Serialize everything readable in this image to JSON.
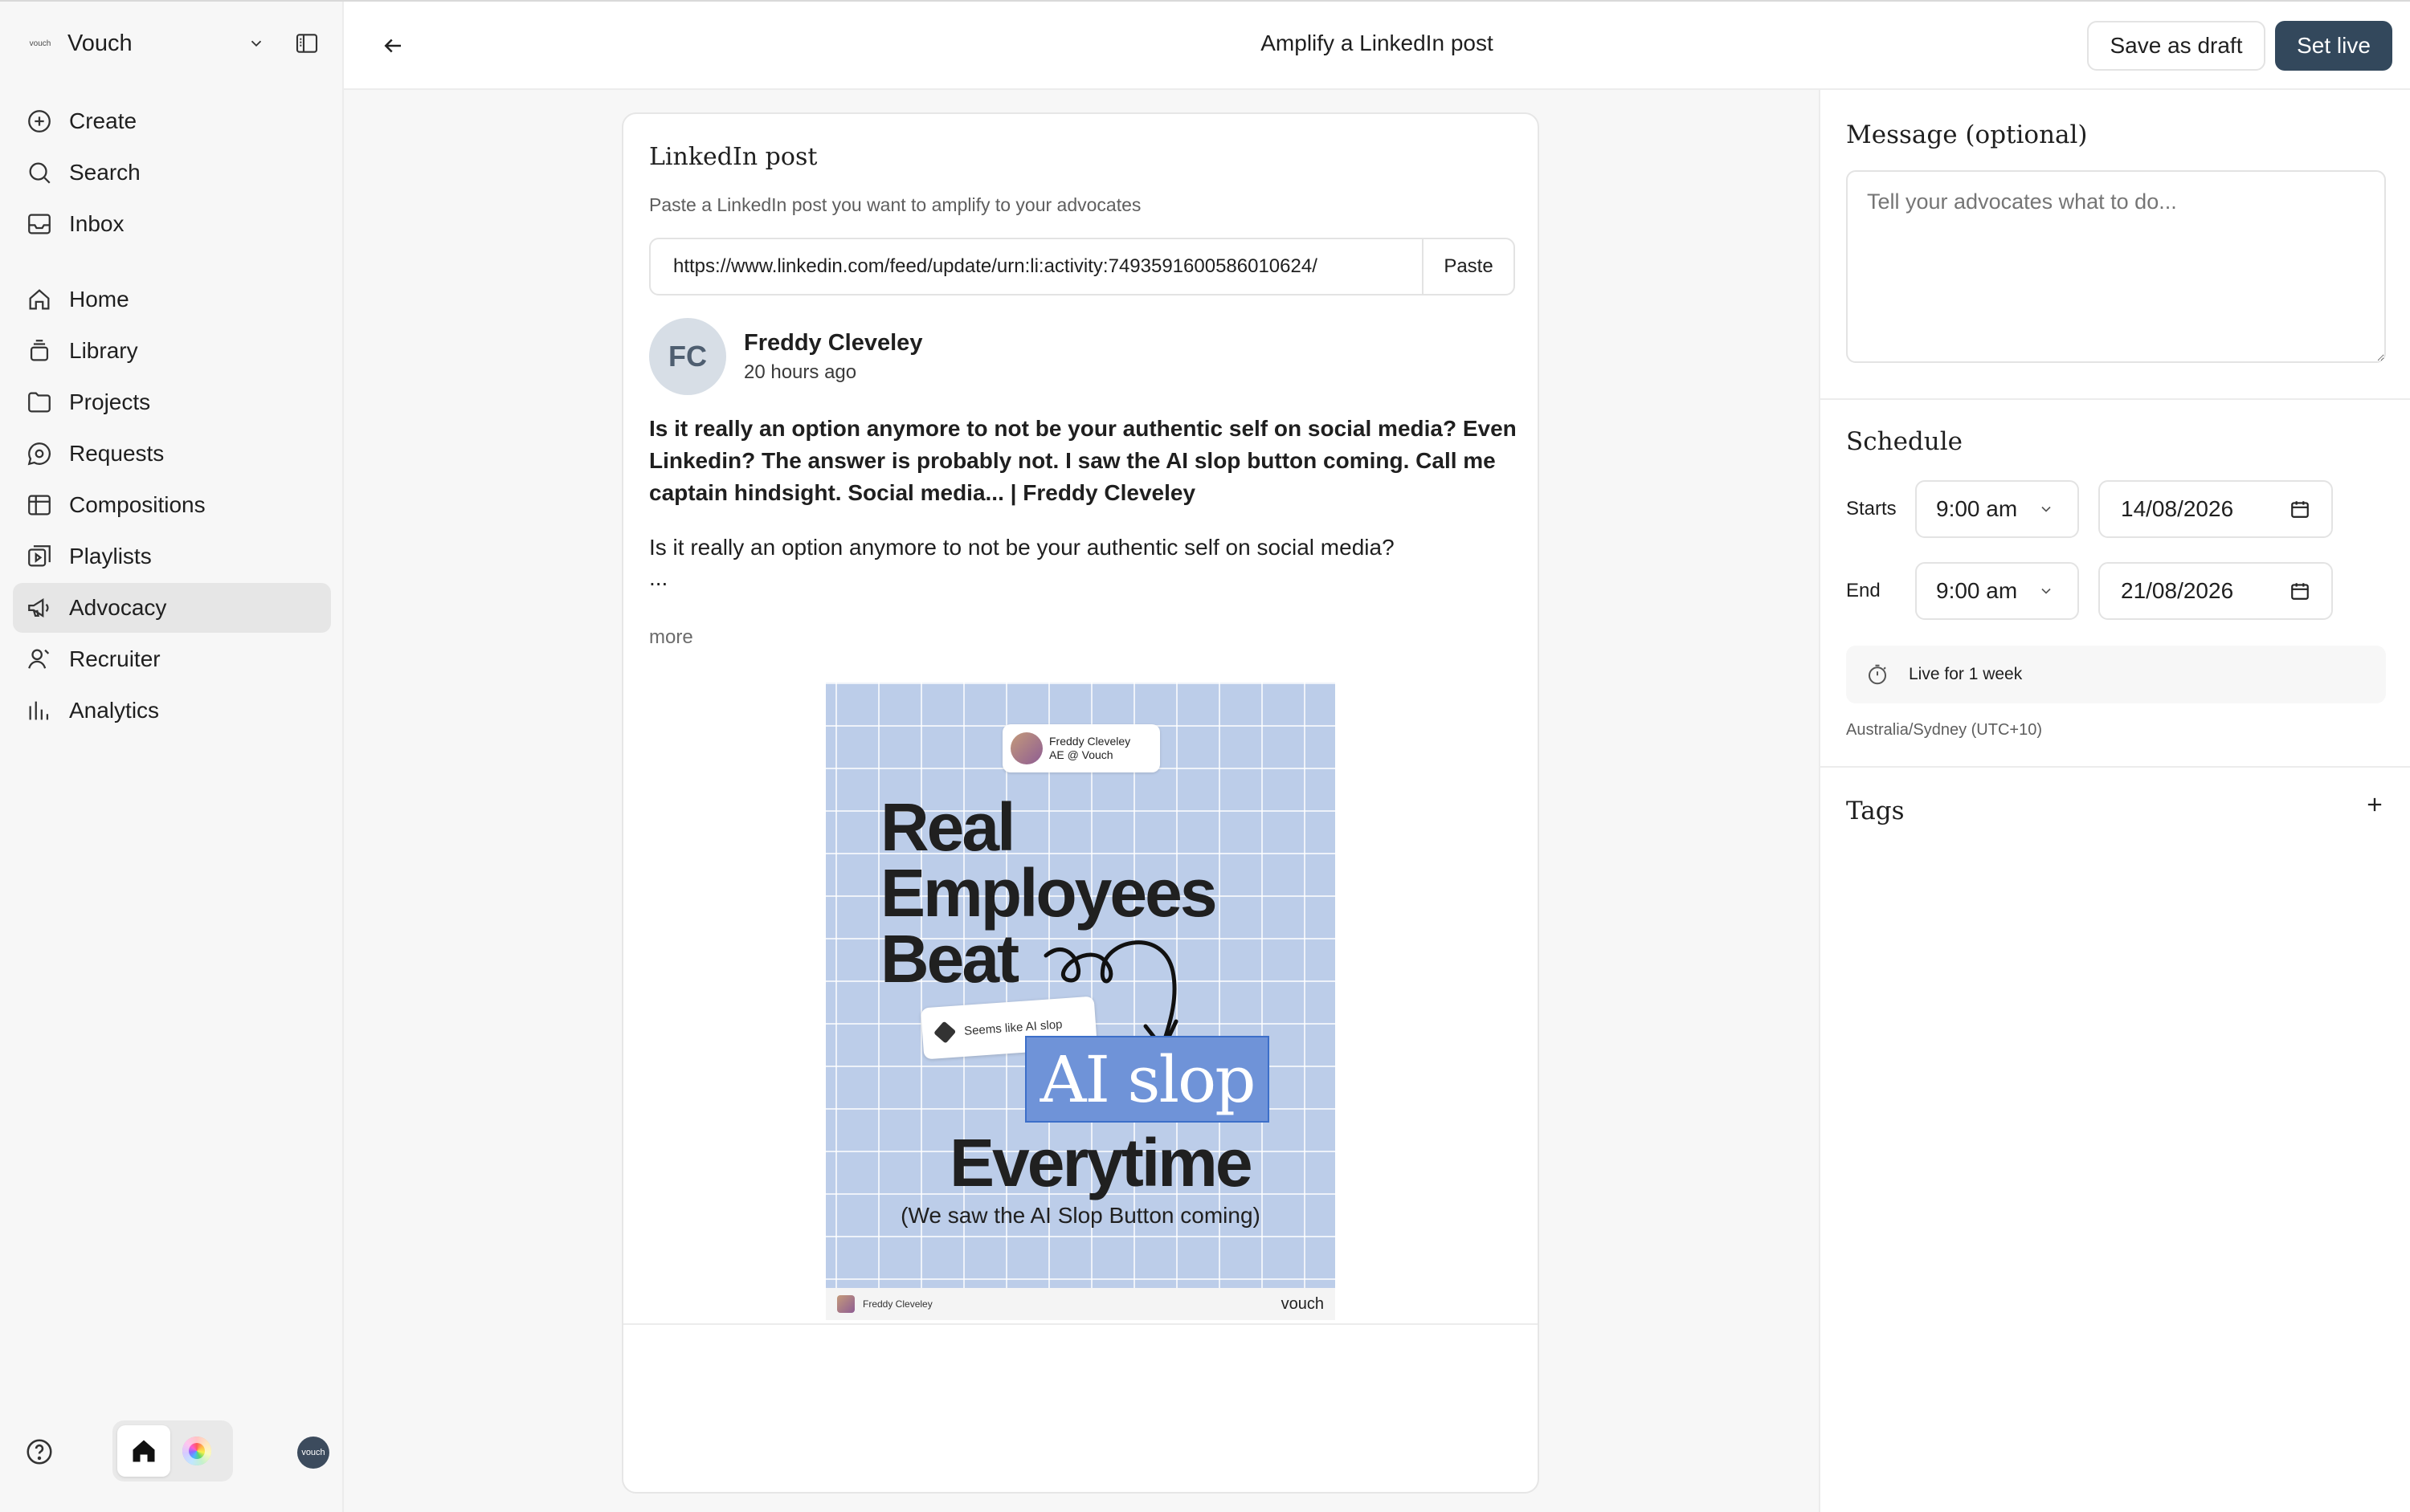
{
  "workspace": {
    "name": "Vouch",
    "logo_text": "vouch"
  },
  "sidebar": {
    "top_items": [
      {
        "label": "Create",
        "icon": "plus-circle-icon"
      },
      {
        "label": "Search",
        "icon": "search-icon"
      },
      {
        "label": "Inbox",
        "icon": "inbox-icon"
      }
    ],
    "main_items": [
      {
        "label": "Home",
        "icon": "home-icon"
      },
      {
        "label": "Library",
        "icon": "library-icon"
      },
      {
        "label": "Projects",
        "icon": "folder-icon"
      },
      {
        "label": "Requests",
        "icon": "chat-icon"
      },
      {
        "label": "Compositions",
        "icon": "grid-icon"
      },
      {
        "label": "Playlists",
        "icon": "playlist-icon"
      },
      {
        "label": "Advocacy",
        "icon": "megaphone-icon",
        "active": true
      },
      {
        "label": "Recruiter",
        "icon": "person-icon"
      },
      {
        "label": "Analytics",
        "icon": "bar-chart-icon"
      }
    ],
    "avatar_text": "vouch"
  },
  "header": {
    "title": "Amplify a LinkedIn post",
    "save_draft_label": "Save as draft",
    "set_live_label": "Set live"
  },
  "post_card": {
    "title": "LinkedIn post",
    "subtitle": "Paste a LinkedIn post you want to amplify to your advocates",
    "url": "https://www.linkedin.com/feed/update/urn:li:activity:7493591600586010624/",
    "paste_label": "Paste",
    "author_initials": "FC",
    "author_name": "Freddy Cleveley",
    "posted_time": "20 hours ago",
    "headline": "Is it really an option anymore to not be your authentic self on social media? Even Linkedin? The answer is probably not. I saw the AI slop button coming. Call me captain hindsight. Social media... | Freddy Cleveley",
    "body": "Is it really an option anymore to not be your authentic self on social media?",
    "ellipsis": "...",
    "more_label": "more",
    "image": {
      "chip_name": "Freddy Cleveley",
      "chip_role": "AE @ Vouch",
      "line1": "Real",
      "line2": "Employees",
      "line3": "Beat",
      "slop_chip": "Seems like AI slop",
      "ai_slop": "AI slop",
      "everytime": "Everytime",
      "caption": "(We saw the AI Slop Button coming)",
      "footer_name": "Freddy Cleveley",
      "footer_brand": "vouch"
    }
  },
  "message": {
    "title": "Message (optional)",
    "placeholder": "Tell your advocates what to do..."
  },
  "schedule": {
    "title": "Schedule",
    "starts_label": "Starts",
    "start_time": "9:00 am",
    "start_date": "14/08/2026",
    "end_label": "End",
    "end_time": "9:00 am",
    "end_date": "21/08/2026",
    "duration": "Live for 1 week",
    "timezone": "Australia/Sydney (UTC+10)"
  },
  "tags": {
    "title": "Tags"
  }
}
